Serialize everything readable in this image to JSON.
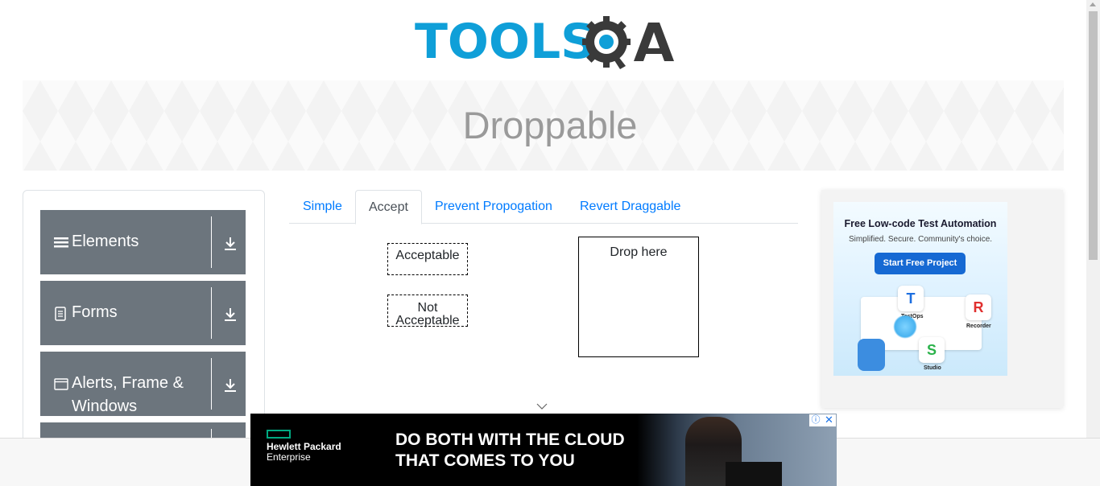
{
  "header": {
    "logo_text": "TOOLS",
    "logo_accent": "QA",
    "brand_blue": "#0f9fd8",
    "brand_dark": "#3a3a3a"
  },
  "banner": {
    "title": "Droppable"
  },
  "sidebar": {
    "groups": [
      {
        "label": "Elements",
        "icon": "menu-lines-icon"
      },
      {
        "label": "Forms",
        "icon": "document-icon"
      },
      {
        "label_line1": "Alerts, Frame &",
        "label_line2": "Windows",
        "icon": "window-icon"
      },
      {
        "label": "",
        "icon": ""
      }
    ],
    "group_color": "#6c757d"
  },
  "tabs": {
    "items": [
      {
        "label": "Simple",
        "active": false
      },
      {
        "label": "Accept",
        "active": true
      },
      {
        "label": "Prevent Propogation",
        "active": false
      },
      {
        "label": "Revert Draggable",
        "active": false
      }
    ],
    "link_color": "#007bff"
  },
  "accept": {
    "acceptable": "Acceptable",
    "not_acceptable_line1": "Not",
    "not_acceptable_line2": "Acceptable",
    "drop_target": "Drop here"
  },
  "right_ad": {
    "headline": "Free Low-code Test Automation",
    "subline": "Simplified. Secure. Community's choice.",
    "button": "Start Free Project",
    "labels": [
      "TestOps",
      "Recorder",
      "Studio"
    ]
  },
  "bottom_ad": {
    "brand_line1": "Hewlett Packard",
    "brand_line2": "Enterprise",
    "headline_line1": "DO BOTH WITH THE CLOUD",
    "headline_line2": "THAT COMES TO YOU",
    "info_glyph": "ⓘ",
    "close_glyph": "✕",
    "accent": "#01a982"
  }
}
